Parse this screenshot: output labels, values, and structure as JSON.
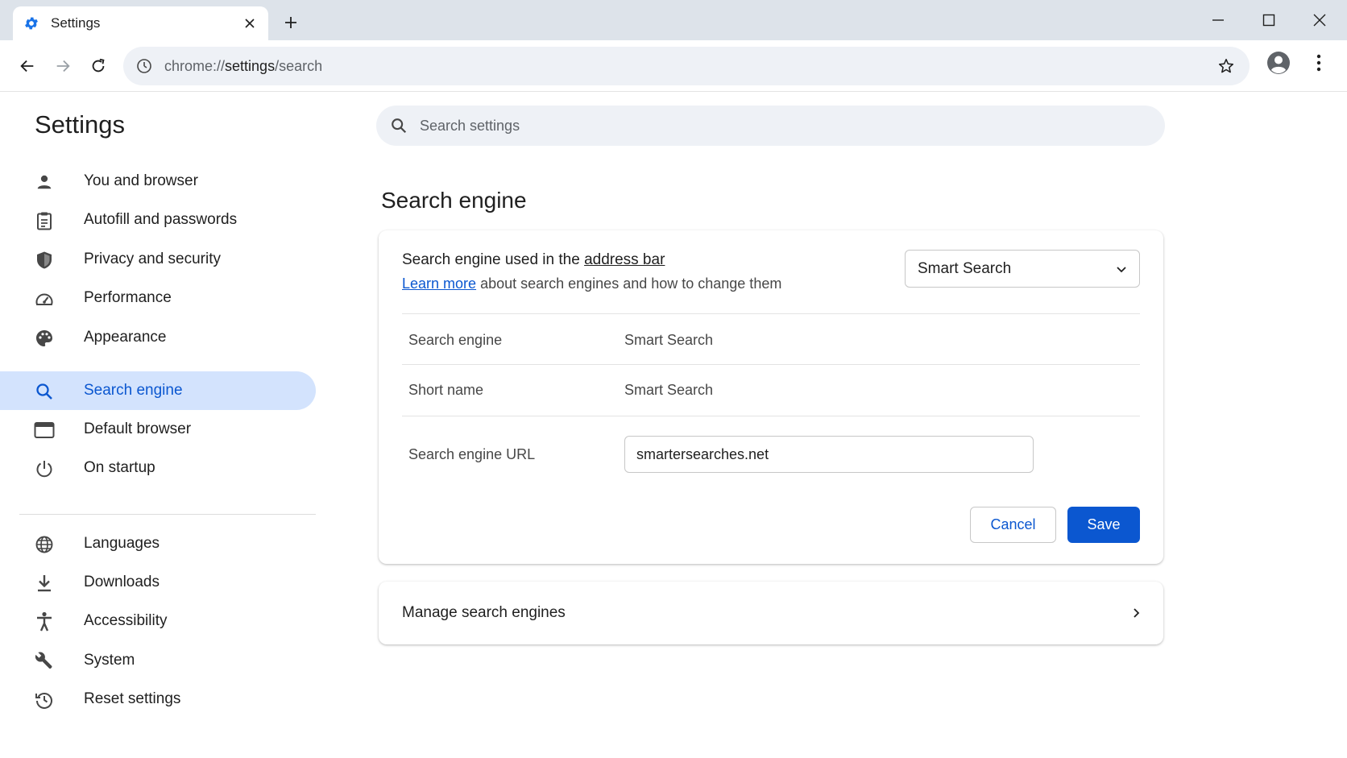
{
  "tab": {
    "title": "Settings",
    "favicon": "gear-icon",
    "close": "close-icon"
  },
  "window_controls": [
    "minimize-icon",
    "maximize-icon",
    "close-icon"
  ],
  "toolbar": {
    "url_scheme": "chrome://",
    "url_host": "settings",
    "url_path": "/search"
  },
  "sidebar": {
    "title": "Settings",
    "items": [
      {
        "label": "You and browser",
        "icon": "person-icon"
      },
      {
        "label": "Autofill and passwords",
        "icon": "clipboard-icon"
      },
      {
        "label": "Privacy and security",
        "icon": "shield-icon"
      },
      {
        "label": "Performance",
        "icon": "speedometer-icon"
      },
      {
        "label": "Appearance",
        "icon": "palette-icon"
      },
      {
        "label": "Search engine",
        "icon": "search-icon",
        "active": true
      },
      {
        "label": "Default browser",
        "icon": "browser-window-icon"
      },
      {
        "label": "On startup",
        "icon": "power-icon"
      }
    ],
    "items2": [
      {
        "label": "Languages",
        "icon": "globe-icon"
      },
      {
        "label": "Downloads",
        "icon": "download-icon"
      },
      {
        "label": "Accessibility",
        "icon": "accessibility-icon"
      },
      {
        "label": "System",
        "icon": "wrench-icon"
      },
      {
        "label": "Reset settings",
        "icon": "reset-history-icon"
      }
    ]
  },
  "search": {
    "placeholder": "Search settings"
  },
  "main": {
    "section_title": "Search engine",
    "card": {
      "line1_prefix": "Search engine used in the ",
      "line1_link": "address bar",
      "learn_more": "Learn more",
      "line2_suffix": " about search engines and how to change them",
      "dropdown_value": "Smart Search",
      "rows": [
        {
          "label": "Search engine",
          "value": "Smart Search"
        },
        {
          "label": "Short name",
          "value": "Smart Search"
        },
        {
          "label": "Search engine URL",
          "value": "smartersearches.net"
        }
      ],
      "cancel_label": "Cancel",
      "save_label": "Save"
    },
    "manage": {
      "label": "Manage search engines"
    }
  },
  "colors": {
    "accent": "#0b57d0",
    "active_nav_bg": "#d3e3fd",
    "tabstrip_bg": "#dde3ea",
    "omnibox_bg": "#eef1f6"
  }
}
